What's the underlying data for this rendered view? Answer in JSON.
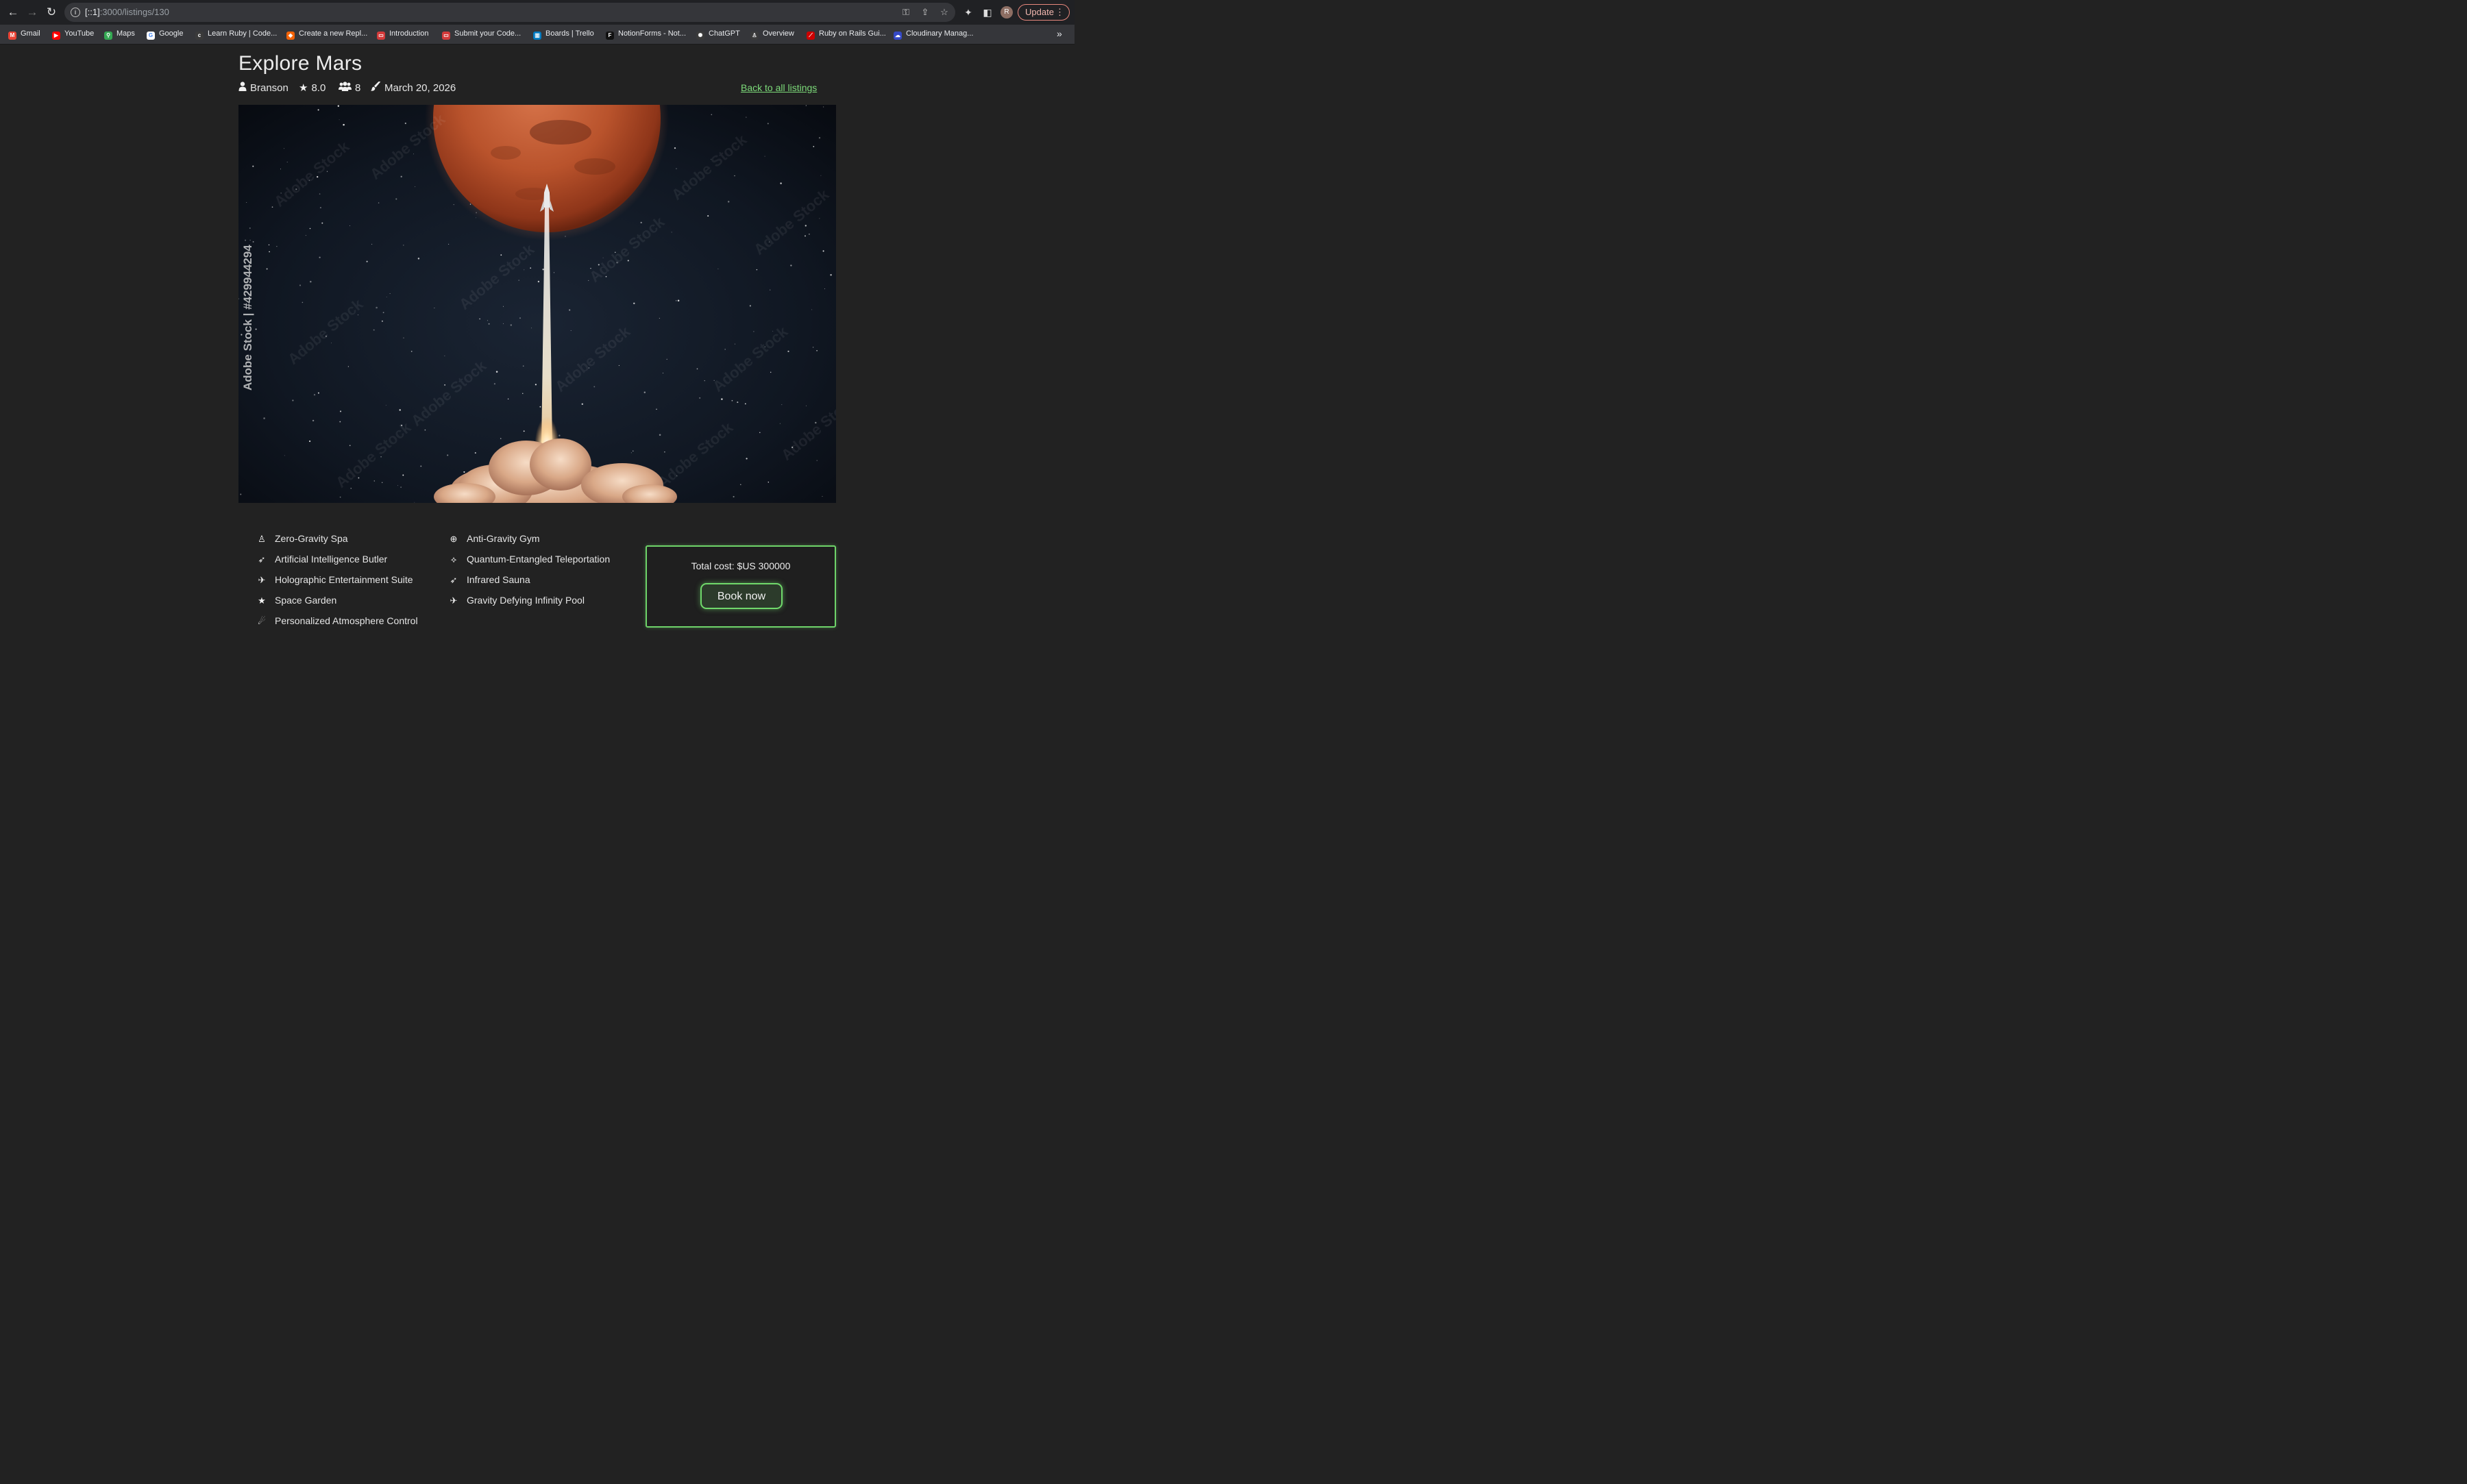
{
  "browser": {
    "url_host": "[::1]",
    "url_path": ":3000/listings/130",
    "update_label": "Update",
    "profile_initial": "R",
    "bookmarks": [
      {
        "label": "Gmail",
        "icon": "gmail-icon",
        "color": "#ea4335",
        "glyph": "M"
      },
      {
        "label": "YouTube",
        "icon": "youtube-icon",
        "color": "#ff0000",
        "glyph": "▶"
      },
      {
        "label": "Maps",
        "icon": "maps-icon",
        "color": "#34a853",
        "glyph": "⚲"
      },
      {
        "label": "Google",
        "icon": "google-icon",
        "color": "#ffffff",
        "glyph": "G"
      },
      {
        "label": "Learn Ruby | Code...",
        "icon": "codecademy-icon",
        "color": "#3a3a3a",
        "glyph": "c"
      },
      {
        "label": "Create a new Repl...",
        "icon": "replit-icon",
        "color": "#f26207",
        "glyph": "◆"
      },
      {
        "label": "Introduction",
        "icon": "course-icon",
        "color": "#d33a3a",
        "glyph": "▭"
      },
      {
        "label": "Submit your Code...",
        "icon": "submit-icon",
        "color": "#d33a3a",
        "glyph": "▭"
      },
      {
        "label": "Boards | Trello",
        "icon": "trello-icon",
        "color": "#0079bf",
        "glyph": "▥"
      },
      {
        "label": "NotionForms - Not...",
        "icon": "notionforms-icon",
        "color": "#111111",
        "glyph": "F"
      },
      {
        "label": "ChatGPT",
        "icon": "chatgpt-icon",
        "color": "#3a3a3a",
        "glyph": "✺"
      },
      {
        "label": "Overview",
        "icon": "overview-icon",
        "color": "#3a3a3a",
        "glyph": "♙"
      },
      {
        "label": "Ruby on Rails Gui...",
        "icon": "rails-icon",
        "color": "#cc0000",
        "glyph": "⟋"
      },
      {
        "label": "Cloudinary Manag...",
        "icon": "cloudinary-icon",
        "color": "#3448c5",
        "glyph": "☁"
      }
    ],
    "more_label": "»"
  },
  "listing": {
    "title": "Explore Mars",
    "host": "Branson",
    "rating": "8.0",
    "guests": "8",
    "date": "March 20, 2026",
    "back_link": "Back to all listings",
    "image_caption": "Adobe Stock | #429944294",
    "watermark": "Adobe Stock",
    "amenities_left": [
      {
        "label": "Zero-Gravity Spa",
        "icon": "spa-person-icon",
        "glyph": "♙"
      },
      {
        "label": "Artificial Intelligence Butler",
        "icon": "rocket-icon",
        "glyph": "➶"
      },
      {
        "label": "Holographic Entertainment Suite",
        "icon": "rocket-launch-icon",
        "glyph": "✈"
      },
      {
        "label": "Space Garden",
        "icon": "star-icon",
        "glyph": "★"
      },
      {
        "label": "Personalized Atmosphere Control",
        "icon": "meteor-icon",
        "glyph": "☄"
      }
    ],
    "amenities_right": [
      {
        "label": "Anti-Gravity Gym",
        "icon": "globe-icon",
        "glyph": "⊕"
      },
      {
        "label": "Quantum-Entangled Teleportation",
        "icon": "satellite-dish-icon",
        "glyph": "⟡"
      },
      {
        "label": "Infrared Sauna",
        "icon": "rocket-icon",
        "glyph": "➶"
      },
      {
        "label": "Gravity Defying Infinity Pool",
        "icon": "rocket-launch-icon",
        "glyph": "✈"
      }
    ],
    "total_cost": "Total cost: $US 300000",
    "book_label": "Book now"
  },
  "colors": {
    "page_bg": "#222222",
    "accent_green": "#6fd46a",
    "link_green": "#7ddc7a",
    "mars": "#c4532b"
  }
}
